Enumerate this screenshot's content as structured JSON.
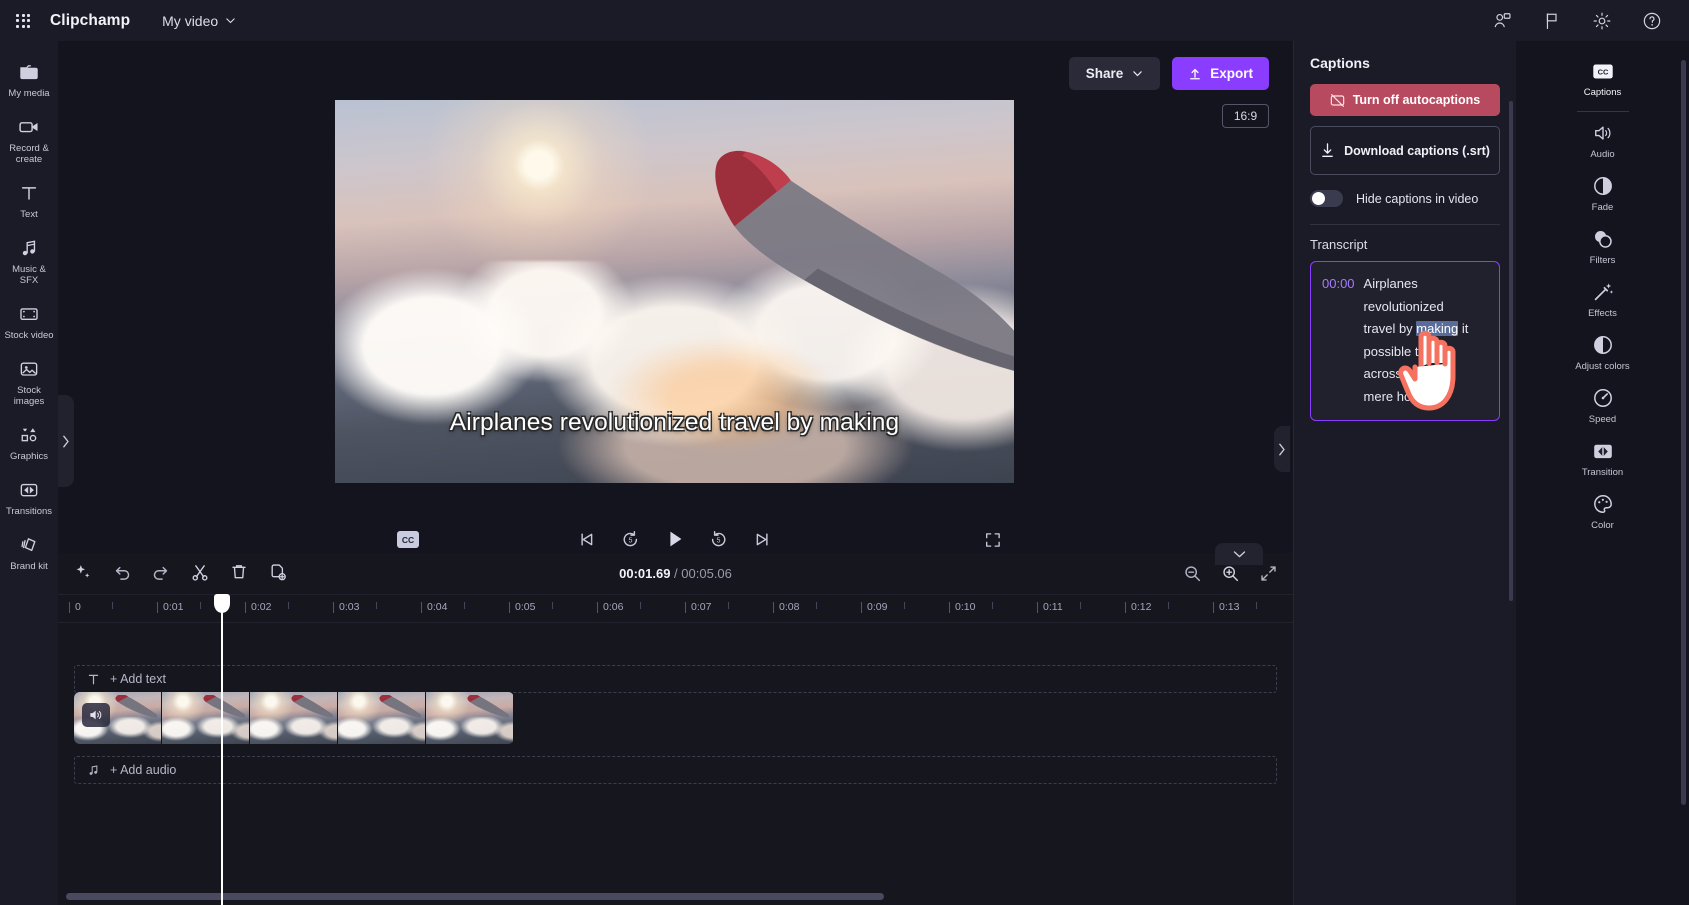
{
  "app": {
    "brand": "Clipchamp",
    "project_name": "My video",
    "waffle_icon": "app-launcher-icon",
    "top_icons": [
      {
        "name": "share-person-icon",
        "label": ""
      },
      {
        "name": "flag-feedback-icon",
        "label": ""
      },
      {
        "name": "gear-settings-icon",
        "label": ""
      },
      {
        "name": "help-question-icon",
        "label": "?"
      }
    ]
  },
  "left_rail": [
    {
      "label": "My media",
      "icon": "folder-icon"
    },
    {
      "label": "Record & create",
      "icon": "video-camera-icon"
    },
    {
      "label": "Text",
      "icon": "text-t-icon"
    },
    {
      "label": "Music & SFX",
      "icon": "music-note-icon"
    },
    {
      "label": "Stock video",
      "icon": "film-strip-icon"
    },
    {
      "label": "Stock images",
      "icon": "image-photo-icon"
    },
    {
      "label": "Graphics",
      "icon": "shapes-icon"
    },
    {
      "label": "Transitions",
      "icon": "transition-icon"
    },
    {
      "label": "Brand kit",
      "icon": "brand-kit-icon"
    }
  ],
  "stage": {
    "share_label": "Share",
    "export_label": "Export",
    "aspect_ratio": "16:9",
    "caption_overlay": "Airplanes revolutionized travel by making",
    "cc_button_label": "CC",
    "transport": [
      {
        "name": "skip-to-start-button",
        "glyph": "skip-start-icon"
      },
      {
        "name": "rewind-5s-button",
        "glyph": "rewind-5-icon"
      },
      {
        "name": "play-button",
        "glyph": "play-icon"
      },
      {
        "name": "forward-5s-button",
        "glyph": "forward-5-icon"
      },
      {
        "name": "skip-to-end-button",
        "glyph": "skip-end-icon"
      }
    ]
  },
  "captions_panel": {
    "title": "Captions",
    "turn_off_label": "Turn off autocaptions",
    "turn_off_color": "#b74a5e",
    "download_label": "Download captions (.srt)",
    "hide_toggle_label": "Hide captions in video",
    "hide_toggle_on": false,
    "transcript_heading": "Transcript",
    "transcript": {
      "timestamp": "00:00",
      "lines": [
        {
          "pre": "Airplanes",
          "hl": "",
          "post": ""
        },
        {
          "pre": "revolutionized",
          "hl": "",
          "post": ""
        },
        {
          "pre": "travel by ",
          "hl": "making",
          "post": " it"
        },
        {
          "pre": "possible to j",
          "hl": "",
          "post": ""
        },
        {
          "pre": "across co",
          "hl": "",
          "post": ""
        },
        {
          "pre": "mere hours.",
          "hl": "",
          "post": ""
        }
      ]
    },
    "accent": "#8b3dff"
  },
  "far_rail": [
    {
      "label": "Captions",
      "icon": "cc-icon",
      "active": true
    },
    {
      "label": "Audio",
      "icon": "speaker-icon",
      "active": false
    },
    {
      "label": "Fade",
      "icon": "fade-circle-icon",
      "active": false
    },
    {
      "label": "Filters",
      "icon": "filters-circles-icon",
      "active": false
    },
    {
      "label": "Effects",
      "icon": "magic-wand-icon",
      "active": false
    },
    {
      "label": "Adjust colors",
      "icon": "half-circle-icon",
      "active": false
    },
    {
      "label": "Speed",
      "icon": "speedometer-icon",
      "active": false
    },
    {
      "label": "Transition",
      "icon": "transition-icon",
      "active": false
    },
    {
      "label": "Color",
      "icon": "palette-icon",
      "active": false
    }
  ],
  "timeline": {
    "tools": [
      {
        "name": "magic-enhance-button",
        "icon": "sparkle-icon"
      },
      {
        "name": "undo-button",
        "icon": "undo-arrow-icon"
      },
      {
        "name": "redo-button",
        "icon": "redo-arrow-icon"
      },
      {
        "name": "split-button",
        "icon": "scissors-icon"
      },
      {
        "name": "delete-button",
        "icon": "trash-icon"
      },
      {
        "name": "duplicate-button",
        "icon": "duplicate-icon"
      }
    ],
    "current_time": "00:01.69",
    "separator": " / ",
    "total_time": "00:05.06",
    "zoom_tools": [
      {
        "name": "zoom-out-button",
        "icon": "magnifier-minus-icon"
      },
      {
        "name": "zoom-in-button",
        "icon": "magnifier-plus-icon"
      },
      {
        "name": "fit-to-screen-button",
        "icon": "fit-arrows-icon"
      }
    ],
    "ruler_ticks": [
      "0",
      "0:01",
      "0:02",
      "0:03",
      "0:04",
      "0:05",
      "0:06",
      "0:07",
      "0:08",
      "0:09",
      "0:10",
      "0:11",
      "0:12",
      "0:13"
    ],
    "add_text_label": "+ Add text",
    "add_audio_label": "+ Add audio",
    "playhead_time": "00:01.69",
    "clip": {
      "frames": 5,
      "muted": false,
      "audio_icon": "speaker-icon"
    }
  }
}
